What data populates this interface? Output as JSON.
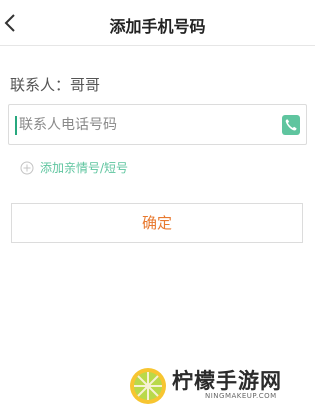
{
  "header": {
    "title": "添加手机号码",
    "back_icon": "chevron-left-icon"
  },
  "contact": {
    "label": "联系人：哥哥"
  },
  "phone_input": {
    "placeholder": "联系人电话号码",
    "value": "",
    "action_icon": "contact-book-icon"
  },
  "add_link": {
    "label": "添加亲情号/短号",
    "icon": "plus-circle-icon"
  },
  "confirm": {
    "label": "确定"
  },
  "watermark": {
    "brand": "柠檬手游网",
    "site": "NINGMAKEUP.COM",
    "logo": "lemon-logo"
  },
  "colors": {
    "accent_green": "#5fc59f",
    "confirm_orange": "#e8792f",
    "border": "#dcdcdc"
  }
}
